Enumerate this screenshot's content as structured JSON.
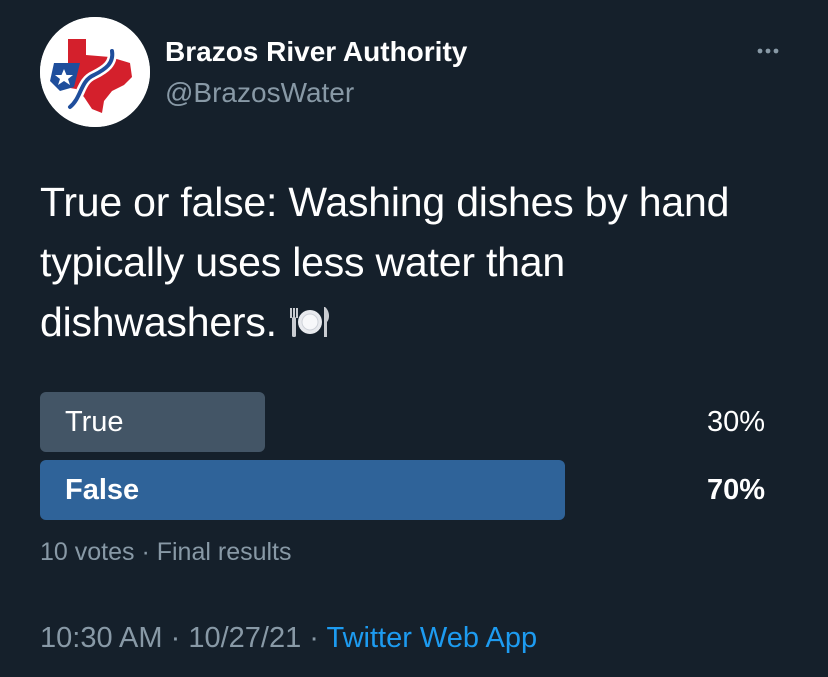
{
  "tweet": {
    "author": {
      "name": "Brazos River Authority",
      "handle": "@BrazosWater",
      "avatar_icon": "brazos-river-authority-logo"
    },
    "more_icon": "more-options-icon",
    "text": "True or false: Washing dishes by hand typically uses less water than dishwashers.",
    "emoji": "fork-and-knife-with-plate-icon",
    "poll": {
      "options": [
        {
          "label": "True",
          "percent_text": "30%",
          "fraction": 0.3
        },
        {
          "label": "False",
          "percent_text": "70%",
          "fraction": 0.7,
          "winner": true
        }
      ],
      "votes": "10 votes",
      "separator": " · ",
      "status": "Final results"
    },
    "time": "10:30 AM",
    "date": "10/27/21",
    "dot": " · ",
    "source": "Twitter Web App"
  },
  "colors": {
    "background": "#15202b",
    "poll_winner": "#2f6399",
    "poll_other": "#435566",
    "secondary_text": "#8899a6",
    "link": "#1d9bf0",
    "logo_red": "#d4202c",
    "logo_blue": "#1f4e9c"
  }
}
